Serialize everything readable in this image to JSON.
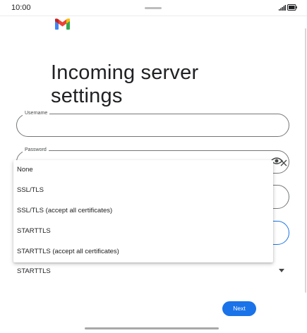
{
  "status_bar": {
    "time": "10:00",
    "icons": [
      "signal-icon",
      "battery-icon"
    ]
  },
  "app": {
    "logo": "gmail-logo-icon",
    "logo_colors": [
      "#4285f4",
      "#34a853",
      "#fbbc04",
      "#ea4335",
      "#c5221f"
    ]
  },
  "page": {
    "title": "Incoming server settings"
  },
  "fields": {
    "username": {
      "label": "Username",
      "value": ""
    },
    "password": {
      "label": "Password",
      "value": "",
      "visibility_icon": "eye-icon"
    }
  },
  "dropdown": {
    "options": [
      "None",
      "SSL/TLS",
      "SSL/TLS (accept all certificates)",
      "STARTTLS",
      "STARTTLS (accept all certificates)"
    ]
  },
  "security_type": {
    "selected": "STARTTLS",
    "icon": "dropdown-arrow-icon"
  },
  "actions": {
    "next_label": "Next"
  },
  "colors": {
    "accent": "#1a73e8",
    "text": "#202124",
    "outline": "#747775"
  }
}
